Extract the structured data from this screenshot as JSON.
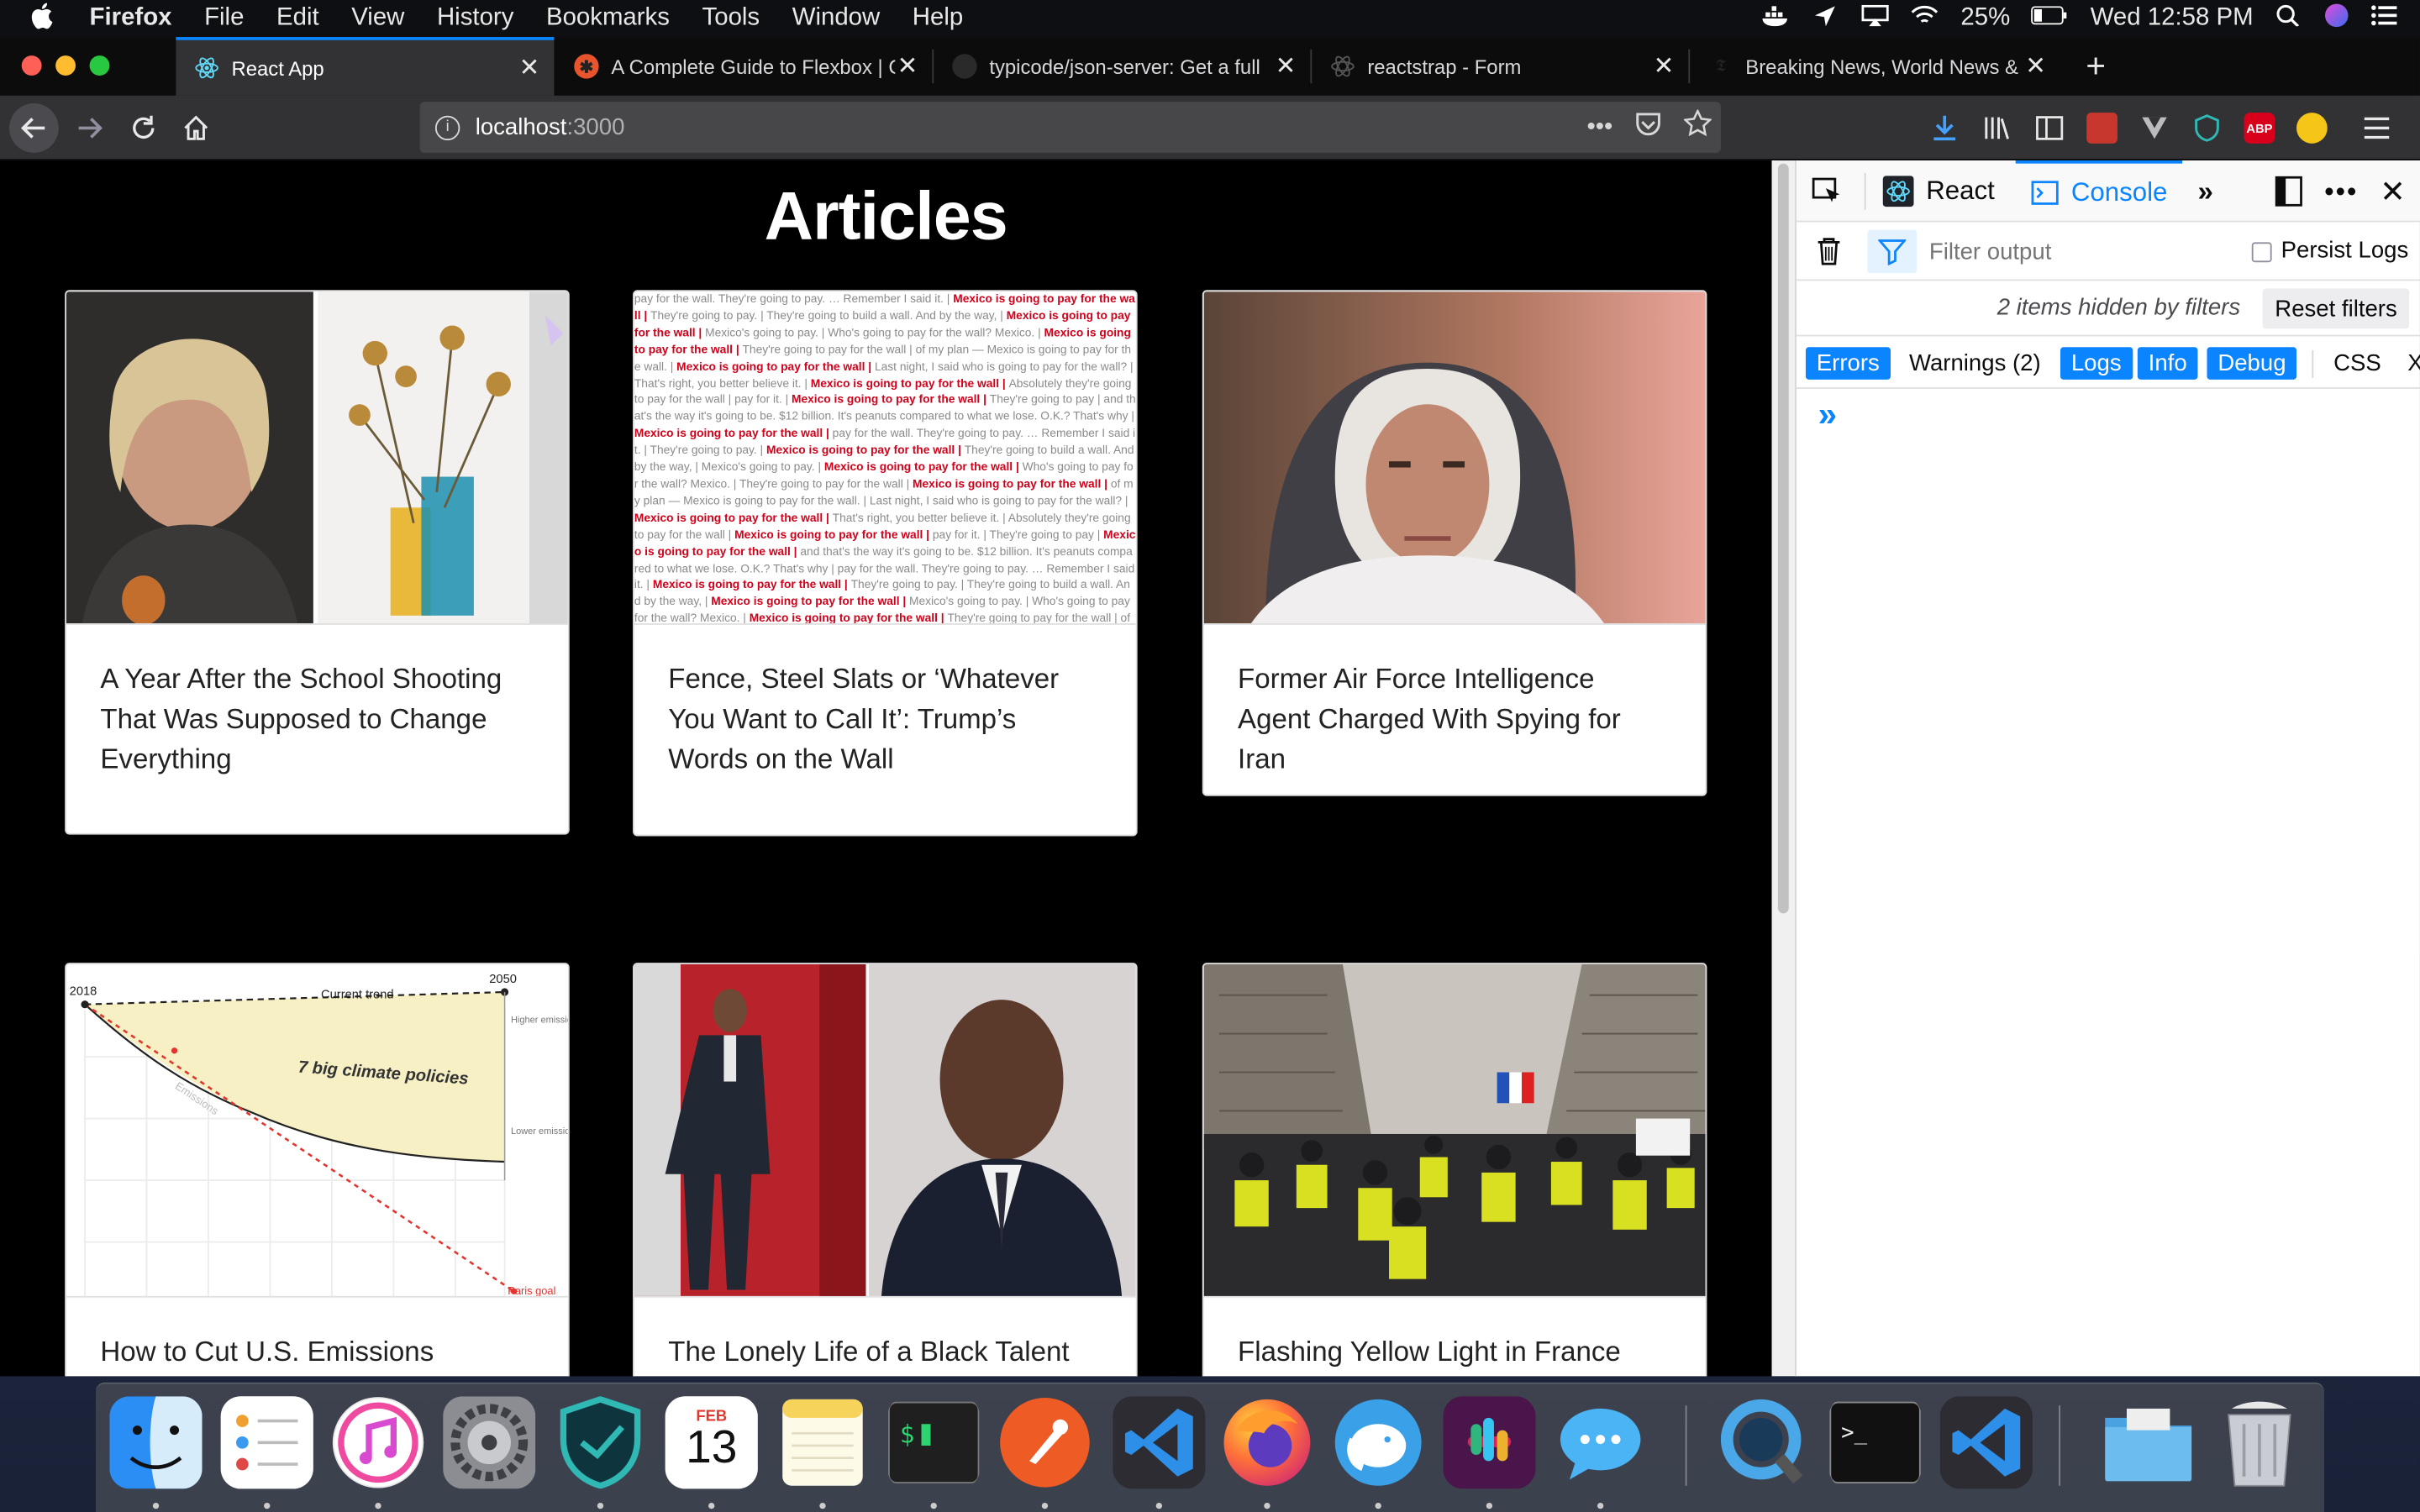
{
  "menubar": {
    "app_name": "Firefox",
    "items": [
      "File",
      "Edit",
      "View",
      "History",
      "Bookmarks",
      "Tools",
      "Window",
      "Help"
    ],
    "battery": "25%",
    "clock": "Wed 12:58 PM"
  },
  "tabs": [
    {
      "title": "React App",
      "icon": "react-icon",
      "active": true
    },
    {
      "title": "A Complete Guide to Flexbox | C",
      "icon": "csstricks-icon",
      "active": false
    },
    {
      "title": "typicode/json-server: Get a full",
      "icon": "github-icon",
      "active": false
    },
    {
      "title": "reactstrap - Form",
      "icon": "react-icon",
      "active": false
    },
    {
      "title": "Breaking News, World News & M",
      "icon": "nyt-icon",
      "active": false
    }
  ],
  "url": {
    "host": "localhost",
    "port": ":3000"
  },
  "page": {
    "title": "Articles",
    "articles": [
      {
        "title": "A Year After the School Shooting That Was Supposed to Change Everything",
        "image": "photo-girl-and-flowers"
      },
      {
        "title": "Fence, Steel Slats or ‘Whatever You Want to Call It’: Trump’s Words on the Wall",
        "image": "text-collage-wall"
      },
      {
        "title": "Former Air Force Intelligence Agent Charged With Spying for Iran",
        "image": "photo-woman-headscarf"
      },
      {
        "title": "How to Cut U.S. Emissions Faster?",
        "image": "chart-emissions"
      },
      {
        "title": "The Lonely Life of a Black Talent",
        "image": "photo-man-in-suit"
      },
      {
        "title": "Flashing Yellow Light in France",
        "image": "photo-yellow-vest-protest"
      }
    ],
    "emissions_chart": {
      "start_year": "2018",
      "end_year": "2050",
      "current_trend": "Current trend",
      "policies": "7 big climate policies",
      "higher": "Higher emissions",
      "lower": "Lower emissions",
      "emissions": "Emissions",
      "goal": "Paris goal"
    },
    "wall_text": {
      "normal": "pay for the wall. They're going to pay. … Remember I said it. | They're going to pay. | They're going to build a wall. And by the way, | Mexico's going to pay. | Who's going to pay for the wall? Mexico. | They're going to pay for the wall | of my plan — Mexico is going to pay for the wall. | Last night, I said who is going to pay for the wall? | That's right, you better believe it. | Absolutely they're going to pay for the wall | pay for it. | They're going to pay | and that's the way it's going to be. $12 billion. It's peanuts compared to what we lose. O.K.? That's why",
      "highlight": "Mexico is going to pay for the wall"
    }
  },
  "devtools": {
    "tabs": [
      "React",
      "Console"
    ],
    "filter_placeholder": "Filter output",
    "persist_logs": "Persist Logs",
    "hidden_message": "2 items hidden by filters",
    "reset_filters": "Reset filters",
    "levels": [
      {
        "label": "Errors",
        "on": true
      },
      {
        "label": "Warnings (2)",
        "on": false
      },
      {
        "label": "Logs",
        "on": true
      },
      {
        "label": "Info",
        "on": true
      },
      {
        "label": "Debug",
        "on": true
      },
      {
        "label": "CSS",
        "on": false
      },
      {
        "label": "X",
        "on": false
      }
    ],
    "prompt": "»"
  },
  "dock": {
    "apps": [
      "Finder",
      "Reminders",
      "iTunes",
      "System Preferences",
      "Dashlane",
      "Calendar",
      "Notes",
      "Terminal",
      "Postman",
      "Visual Studio Code",
      "Firefox",
      "TablePlus",
      "Slack",
      "Messages",
      "QuickTime Player",
      "Terminal",
      "Visual Studio Code",
      "Downloads",
      "Trash"
    ],
    "calendar_month": "FEB",
    "calendar_day": "13"
  },
  "colors": {
    "accent": "#0a84ff",
    "page_bg": "#000000",
    "tab_active": "#323234",
    "red_headline": "#d0021b"
  }
}
